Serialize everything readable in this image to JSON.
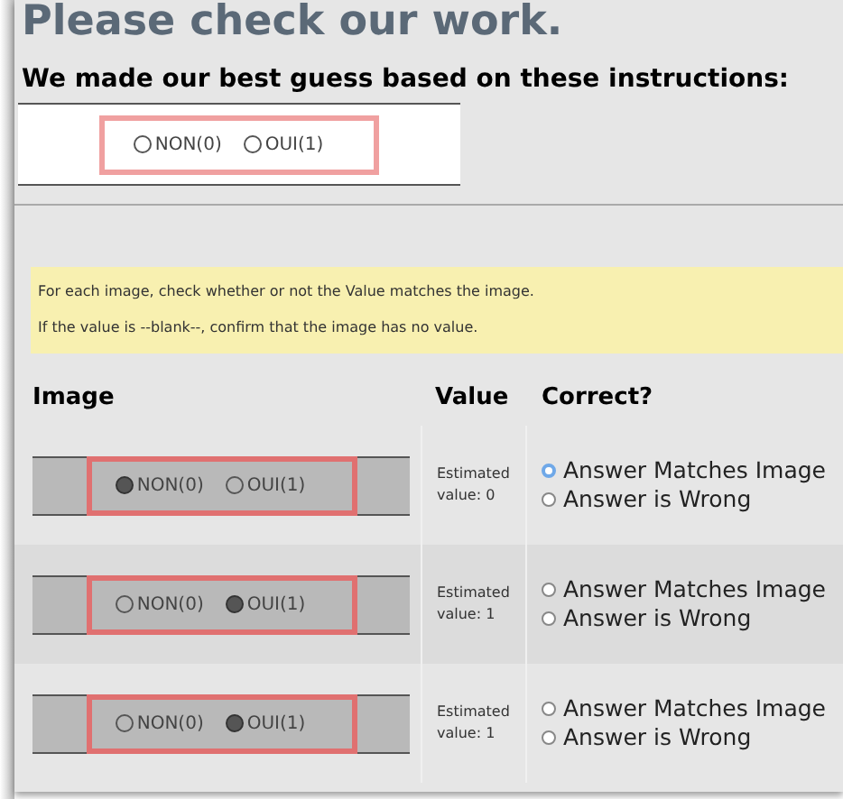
{
  "title": "Please check our work.",
  "subtitle": "We made our best guess based on these instructions:",
  "example": {
    "options": [
      {
        "label": "NON(0)",
        "filled": false
      },
      {
        "label": "OUI(1)",
        "filled": false
      }
    ]
  },
  "instructions": [
    "For each image, check whether or not the Value matches the image.",
    "If the value is --blank--, confirm that the image has no value."
  ],
  "table": {
    "columns": [
      "Image",
      "Value",
      "Correct?"
    ],
    "rows": [
      {
        "image_options": [
          {
            "label": "NON(0)",
            "filled": true
          },
          {
            "label": "OUI(1)",
            "filled": false
          }
        ],
        "value": "Estimated value: 0",
        "answers": [
          {
            "label": "Answer Matches Image",
            "selected": false,
            "focused": true
          },
          {
            "label": "Answer is Wrong",
            "selected": false,
            "focused": false
          }
        ]
      },
      {
        "image_options": [
          {
            "label": "NON(0)",
            "filled": false
          },
          {
            "label": "OUI(1)",
            "filled": true
          }
        ],
        "value": "Estimated value: 1",
        "answers": [
          {
            "label": "Answer Matches Image",
            "selected": false,
            "focused": false
          },
          {
            "label": "Answer is Wrong",
            "selected": false,
            "focused": false
          }
        ]
      },
      {
        "image_options": [
          {
            "label": "NON(0)",
            "filled": false
          },
          {
            "label": "OUI(1)",
            "filled": true
          }
        ],
        "value": "Estimated value: 1",
        "answers": [
          {
            "label": "Answer Matches Image",
            "selected": false,
            "focused": false
          },
          {
            "label": "Answer is Wrong",
            "selected": false,
            "focused": false
          }
        ]
      }
    ]
  }
}
